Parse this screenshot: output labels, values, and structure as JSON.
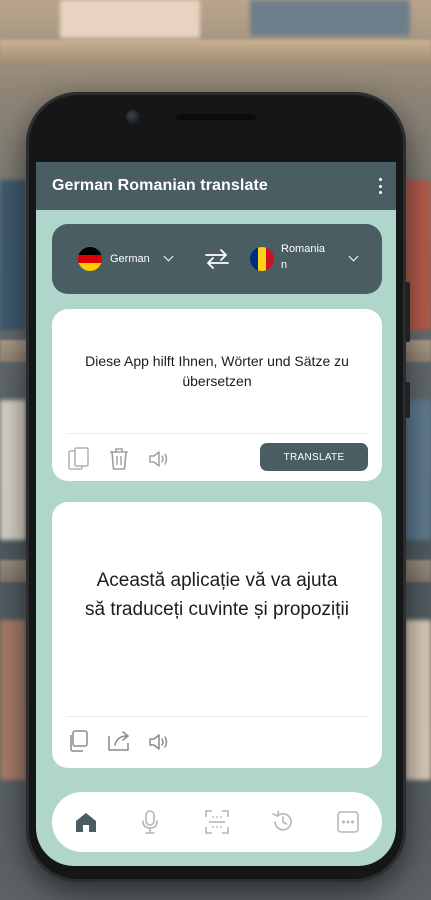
{
  "app": {
    "title": "German Romanian translate"
  },
  "languages": {
    "source": {
      "name": "German"
    },
    "target": {
      "name_line1": "Romania",
      "name_line2": "n"
    }
  },
  "input_card": {
    "text": "Diese App hilft Ihnen, Wörter und Sätze zu übersetzen",
    "translate_label": "TRANSLATE",
    "icons": [
      "paste-icon",
      "trash-icon",
      "speaker-icon"
    ]
  },
  "output_card": {
    "text": "Această aplicație vă va ajuta să traduceți cuvinte și propoziții",
    "icons": [
      "copy-icon",
      "share-icon",
      "speaker-icon"
    ]
  },
  "bottom_nav": {
    "items": [
      "home-icon",
      "microphone-icon",
      "scan-icon",
      "history-icon",
      "more-icon"
    ],
    "active": "home-icon"
  },
  "colors": {
    "accent": "#4a5d62",
    "screen_bg": "#b0d5cb",
    "card_bg": "#ffffff",
    "flag_de": [
      "#000000",
      "#dd0000",
      "#ffce00"
    ],
    "flag_ro": [
      "#002b7f",
      "#fcd116",
      "#ce1126"
    ]
  }
}
